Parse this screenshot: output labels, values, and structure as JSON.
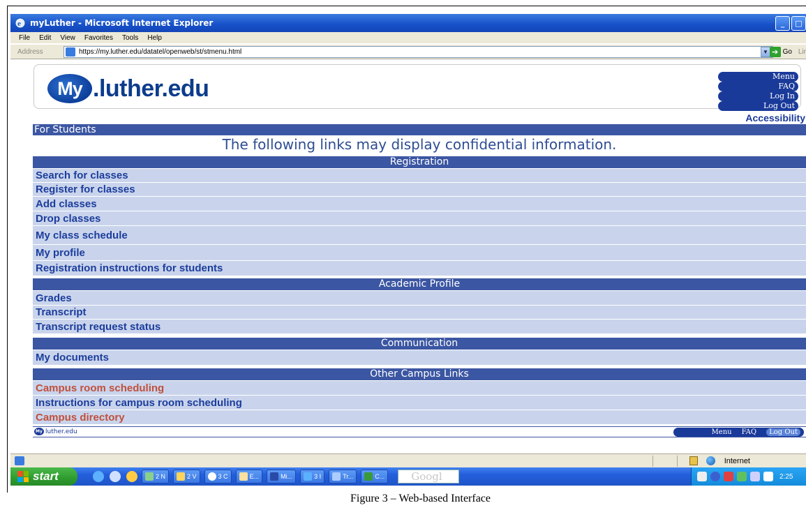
{
  "window": {
    "title": "myLuther - Microsoft Internet Explorer",
    "menu": [
      "File",
      "Edit",
      "View",
      "Favorites",
      "Tools",
      "Help"
    ],
    "address_label": "Address",
    "url": "https://my.luther.edu/datatel/openweb/st/stmenu.html",
    "go_label": "Go",
    "links_label": "Lir"
  },
  "site": {
    "logo_my": "My",
    "logo_domain": ".luther.edu",
    "nav": [
      "Menu",
      "FAQ",
      "Log In",
      "Log Out"
    ],
    "accessibility": "Accessibility",
    "for_students": "For Students",
    "confidential": "The following links may display confidential information.",
    "sections": [
      {
        "title": "Registration",
        "links": [
          "Search for classes",
          "Register for classes",
          "Add classes",
          "Drop classes",
          "My class schedule",
          "My profile",
          "Registration instructions for students"
        ]
      },
      {
        "title": "Academic Profile",
        "links": [
          "Grades",
          "Transcript",
          "Transcript request status"
        ]
      },
      {
        "title": "Communication",
        "links": [
          "My documents"
        ]
      },
      {
        "title": "Other Campus Links",
        "links": [
          "Campus room scheduling",
          "Instructions for campus room scheduling",
          "Campus directory"
        ]
      }
    ],
    "footer_logo": "luther.edu",
    "footer_nav": [
      "Menu",
      "FAQ",
      "Log Out"
    ]
  },
  "statusbar": {
    "zone": "Internet"
  },
  "taskbar": {
    "start": "start",
    "tasks": [
      "2 N",
      "2 V",
      "3 C",
      "E...",
      "Mi...",
      "3 I",
      "Tr...",
      "C..."
    ],
    "search_text": "Googl",
    "clock": "2:25"
  },
  "caption": "Figure 3 – Web-based Interface",
  "colors": {
    "section_bar": "#3b56a2",
    "row_bg": "#c9d4ec",
    "link_blue": "#1c3d9c",
    "link_red": "#c0503b"
  }
}
